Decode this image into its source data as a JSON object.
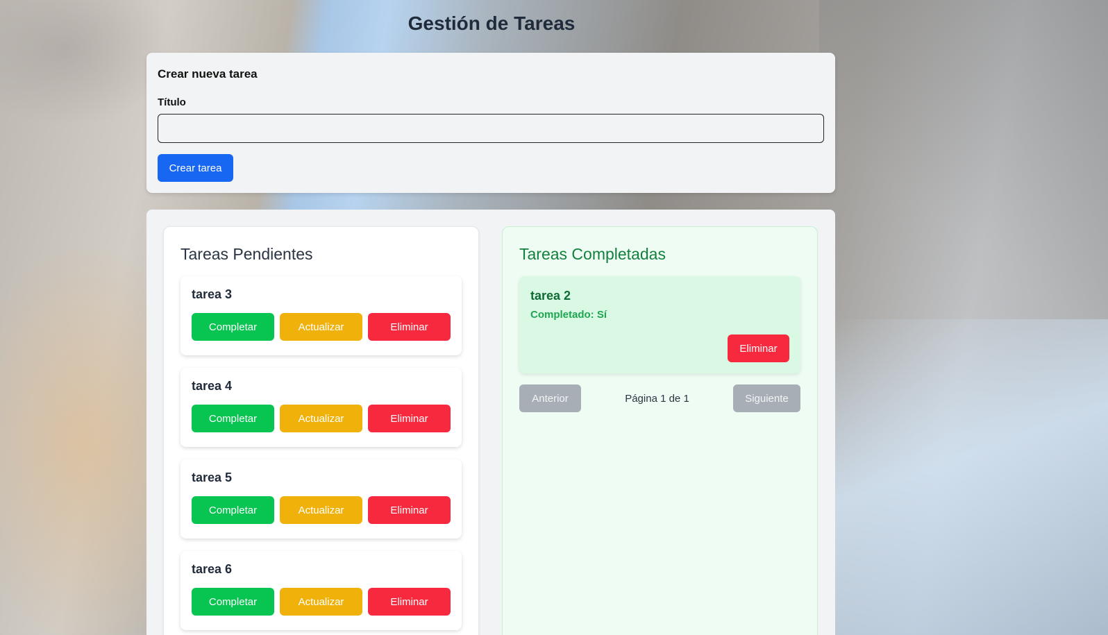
{
  "page": {
    "title": "Gestión de Tareas"
  },
  "create_form": {
    "heading": "Crear nueva tarea",
    "title_label": "Título",
    "title_value": "",
    "submit_label": "Crear tarea"
  },
  "pending": {
    "heading": "Tareas Pendientes",
    "tasks": [
      {
        "title": "tarea 3",
        "complete_label": "Completar",
        "update_label": "Actualizar",
        "delete_label": "Eliminar"
      },
      {
        "title": "tarea 4",
        "complete_label": "Completar",
        "update_label": "Actualizar",
        "delete_label": "Eliminar"
      },
      {
        "title": "tarea 5",
        "complete_label": "Completar",
        "update_label": "Actualizar",
        "delete_label": "Eliminar"
      },
      {
        "title": "tarea 6",
        "complete_label": "Completar",
        "update_label": "Actualizar",
        "delete_label": "Eliminar"
      }
    ]
  },
  "completed": {
    "heading": "Tareas Completadas",
    "tasks": [
      {
        "title": "tarea 2",
        "status": "Completado: Sí",
        "delete_label": "Eliminar"
      }
    ],
    "pagination": {
      "prev_label": "Anterior",
      "page_info": "Página 1 de 1",
      "next_label": "Siguiente"
    }
  },
  "colors": {
    "primary": "#1767f3",
    "complete": "#08c451",
    "update": "#efb10a",
    "delete": "#f6293e",
    "disabled": "#a7aeb5",
    "completed_heading": "#13803f"
  }
}
